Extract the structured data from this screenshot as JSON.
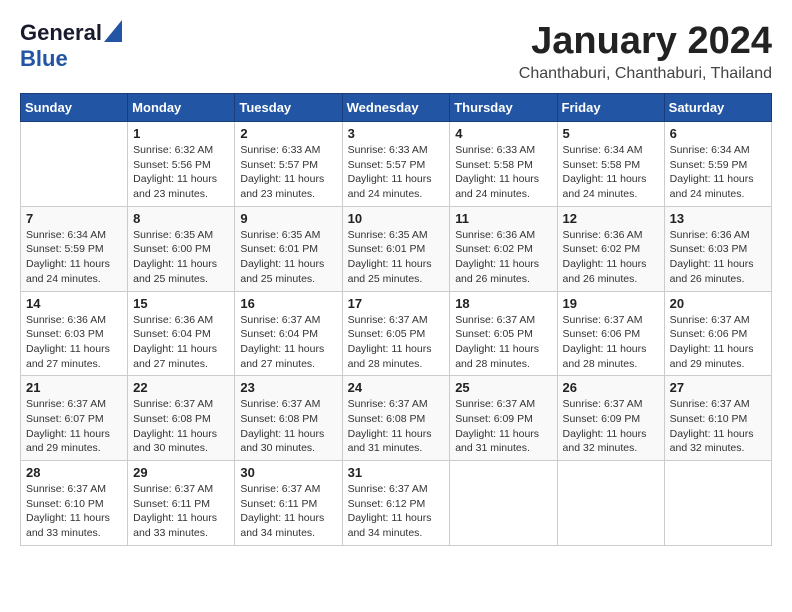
{
  "header": {
    "logo_general": "General",
    "logo_blue": "Blue",
    "title": "January 2024",
    "location": "Chanthaburi, Chanthaburi, Thailand"
  },
  "columns": [
    "Sunday",
    "Monday",
    "Tuesday",
    "Wednesday",
    "Thursday",
    "Friday",
    "Saturday"
  ],
  "weeks": [
    [
      {
        "day": "",
        "info": ""
      },
      {
        "day": "1",
        "info": "Sunrise: 6:32 AM\nSunset: 5:56 PM\nDaylight: 11 hours\nand 23 minutes."
      },
      {
        "day": "2",
        "info": "Sunrise: 6:33 AM\nSunset: 5:57 PM\nDaylight: 11 hours\nand 23 minutes."
      },
      {
        "day": "3",
        "info": "Sunrise: 6:33 AM\nSunset: 5:57 PM\nDaylight: 11 hours\nand 24 minutes."
      },
      {
        "day": "4",
        "info": "Sunrise: 6:33 AM\nSunset: 5:58 PM\nDaylight: 11 hours\nand 24 minutes."
      },
      {
        "day": "5",
        "info": "Sunrise: 6:34 AM\nSunset: 5:58 PM\nDaylight: 11 hours\nand 24 minutes."
      },
      {
        "day": "6",
        "info": "Sunrise: 6:34 AM\nSunset: 5:59 PM\nDaylight: 11 hours\nand 24 minutes."
      }
    ],
    [
      {
        "day": "7",
        "info": "Sunrise: 6:34 AM\nSunset: 5:59 PM\nDaylight: 11 hours\nand 24 minutes."
      },
      {
        "day": "8",
        "info": "Sunrise: 6:35 AM\nSunset: 6:00 PM\nDaylight: 11 hours\nand 25 minutes."
      },
      {
        "day": "9",
        "info": "Sunrise: 6:35 AM\nSunset: 6:01 PM\nDaylight: 11 hours\nand 25 minutes."
      },
      {
        "day": "10",
        "info": "Sunrise: 6:35 AM\nSunset: 6:01 PM\nDaylight: 11 hours\nand 25 minutes."
      },
      {
        "day": "11",
        "info": "Sunrise: 6:36 AM\nSunset: 6:02 PM\nDaylight: 11 hours\nand 26 minutes."
      },
      {
        "day": "12",
        "info": "Sunrise: 6:36 AM\nSunset: 6:02 PM\nDaylight: 11 hours\nand 26 minutes."
      },
      {
        "day": "13",
        "info": "Sunrise: 6:36 AM\nSunset: 6:03 PM\nDaylight: 11 hours\nand 26 minutes."
      }
    ],
    [
      {
        "day": "14",
        "info": "Sunrise: 6:36 AM\nSunset: 6:03 PM\nDaylight: 11 hours\nand 27 minutes."
      },
      {
        "day": "15",
        "info": "Sunrise: 6:36 AM\nSunset: 6:04 PM\nDaylight: 11 hours\nand 27 minutes."
      },
      {
        "day": "16",
        "info": "Sunrise: 6:37 AM\nSunset: 6:04 PM\nDaylight: 11 hours\nand 27 minutes."
      },
      {
        "day": "17",
        "info": "Sunrise: 6:37 AM\nSunset: 6:05 PM\nDaylight: 11 hours\nand 28 minutes."
      },
      {
        "day": "18",
        "info": "Sunrise: 6:37 AM\nSunset: 6:05 PM\nDaylight: 11 hours\nand 28 minutes."
      },
      {
        "day": "19",
        "info": "Sunrise: 6:37 AM\nSunset: 6:06 PM\nDaylight: 11 hours\nand 28 minutes."
      },
      {
        "day": "20",
        "info": "Sunrise: 6:37 AM\nSunset: 6:06 PM\nDaylight: 11 hours\nand 29 minutes."
      }
    ],
    [
      {
        "day": "21",
        "info": "Sunrise: 6:37 AM\nSunset: 6:07 PM\nDaylight: 11 hours\nand 29 minutes."
      },
      {
        "day": "22",
        "info": "Sunrise: 6:37 AM\nSunset: 6:08 PM\nDaylight: 11 hours\nand 30 minutes."
      },
      {
        "day": "23",
        "info": "Sunrise: 6:37 AM\nSunset: 6:08 PM\nDaylight: 11 hours\nand 30 minutes."
      },
      {
        "day": "24",
        "info": "Sunrise: 6:37 AM\nSunset: 6:08 PM\nDaylight: 11 hours\nand 31 minutes."
      },
      {
        "day": "25",
        "info": "Sunrise: 6:37 AM\nSunset: 6:09 PM\nDaylight: 11 hours\nand 31 minutes."
      },
      {
        "day": "26",
        "info": "Sunrise: 6:37 AM\nSunset: 6:09 PM\nDaylight: 11 hours\nand 32 minutes."
      },
      {
        "day": "27",
        "info": "Sunrise: 6:37 AM\nSunset: 6:10 PM\nDaylight: 11 hours\nand 32 minutes."
      }
    ],
    [
      {
        "day": "28",
        "info": "Sunrise: 6:37 AM\nSunset: 6:10 PM\nDaylight: 11 hours\nand 33 minutes."
      },
      {
        "day": "29",
        "info": "Sunrise: 6:37 AM\nSunset: 6:11 PM\nDaylight: 11 hours\nand 33 minutes."
      },
      {
        "day": "30",
        "info": "Sunrise: 6:37 AM\nSunset: 6:11 PM\nDaylight: 11 hours\nand 34 minutes."
      },
      {
        "day": "31",
        "info": "Sunrise: 6:37 AM\nSunset: 6:12 PM\nDaylight: 11 hours\nand 34 minutes."
      },
      {
        "day": "",
        "info": ""
      },
      {
        "day": "",
        "info": ""
      },
      {
        "day": "",
        "info": ""
      }
    ]
  ]
}
